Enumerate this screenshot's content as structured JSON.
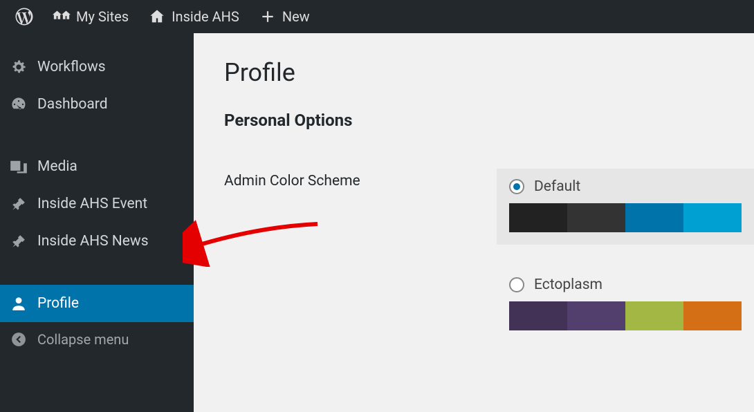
{
  "adminbar": {
    "mysites": "My Sites",
    "site": "Inside AHS",
    "new": "New"
  },
  "sidebar": {
    "items": [
      {
        "key": "workflows",
        "label": "Workflows"
      },
      {
        "key": "dashboard",
        "label": "Dashboard"
      },
      {
        "key": "media",
        "label": "Media"
      },
      {
        "key": "event",
        "label": "Inside AHS Event"
      },
      {
        "key": "news",
        "label": "Inside AHS News"
      },
      {
        "key": "profile",
        "label": "Profile"
      }
    ],
    "collapse": "Collapse menu"
  },
  "page": {
    "title": "Profile",
    "section": "Personal Options",
    "colorscheme_label": "Admin Color Scheme"
  },
  "schemes": {
    "default": {
      "label": "Default",
      "selected": true,
      "colors": [
        "#222222",
        "#333333",
        "#0073aa",
        "#00a0d2"
      ]
    },
    "ectoplasm": {
      "label": "Ectoplasm",
      "selected": false,
      "colors": [
        "#413256",
        "#523f6d",
        "#a3b745",
        "#d46f15"
      ]
    }
  }
}
